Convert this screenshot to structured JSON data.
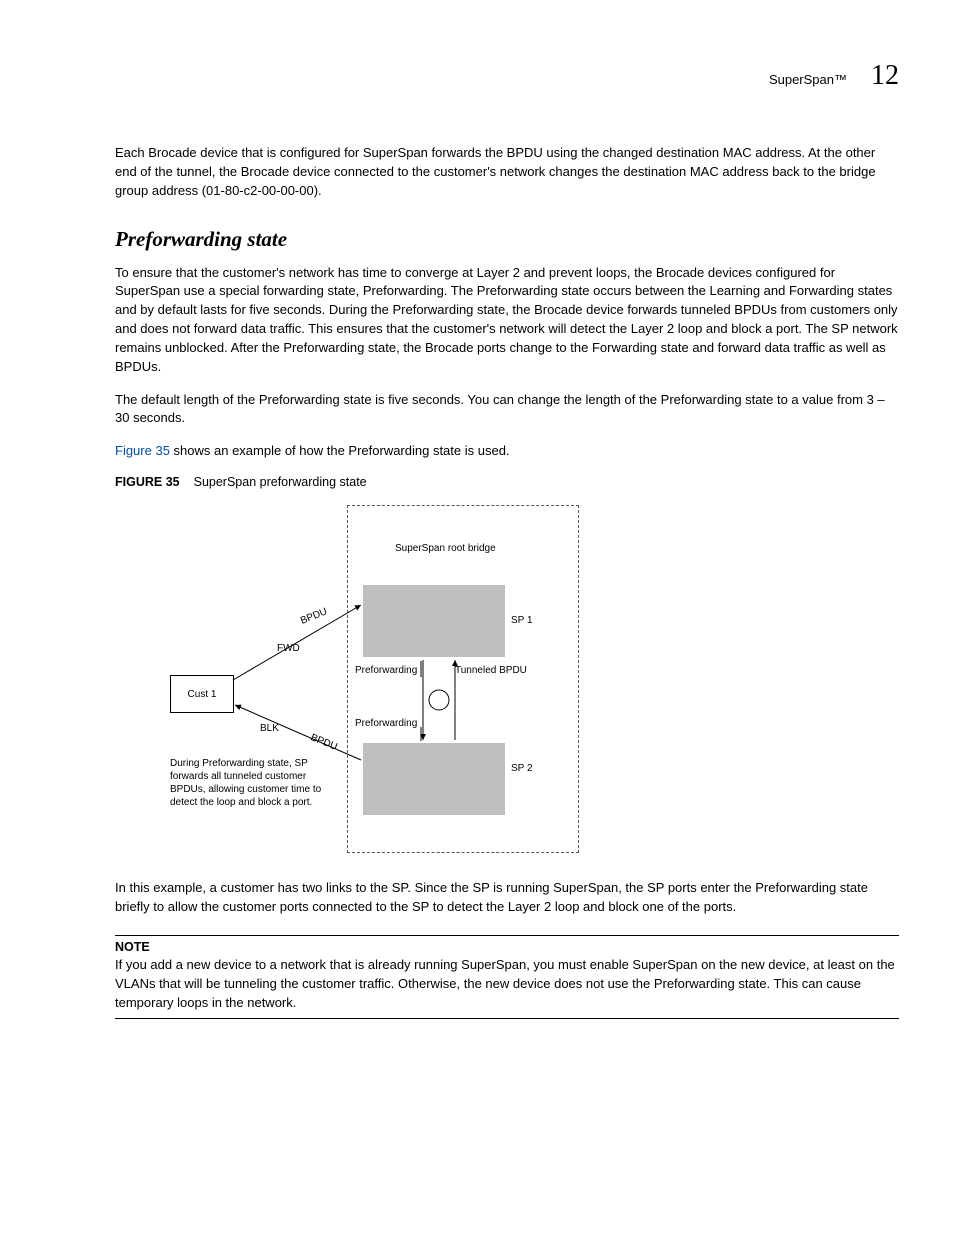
{
  "header": {
    "topic": "SuperSpan™",
    "chapter": "12"
  },
  "intro_para": "Each Brocade device that is configured for SuperSpan forwards the BPDU using the changed destination MAC address.  At the other end of the tunnel, the Brocade device connected to the customer's network changes the destination MAC address back to the bridge group address (01-80-c2-00-00-00).",
  "section_title": "Preforwarding state",
  "p1": "To ensure that the customer's network has time to converge at Layer 2 and prevent loops, the Brocade devices configured for SuperSpan use a special forwarding state, Preforwarding.  The Preforwarding state occurs between the Learning and Forwarding states and by default lasts for five seconds.  During the Preforwarding state, the Brocade device forwards tunneled BPDUs from customers only and does not forward data traffic.  This ensures that the customer's network will detect the Layer 2 loop and block a port.  The SP network remains unblocked.  After the Preforwarding state, the Brocade ports change to the Forwarding state and forward data traffic as well as BPDUs.",
  "p2": "The default length of the Preforwarding state is five seconds.  You can change the length of the Preforwarding state to a value from 3 – 30 seconds.",
  "p3_prefix": "",
  "figref": "Figure 35",
  "p3_suffix": " shows an example of how the Preforwarding state is used.",
  "figcap_label": "FIGURE 35",
  "figcap_text": "SuperSpan preforwarding state",
  "diagram": {
    "superspan": "SuperSpan root bridge",
    "sp1": "SP 1",
    "sp2": "SP 2",
    "cust": "Cust 1",
    "fwd": "FWD",
    "blk": "BLK",
    "pref": "Preforwarding",
    "tunnel": "Tunneled BPDU",
    "bpdu": "BPDU",
    "explain": "During Preforwarding state, SP forwards all tunneled customer BPDUs, allowing customer time to detect the loop and block a port."
  },
  "p4": "In this example, a customer has two links to the SP.  Since the SP is running SuperSpan, the SP ports enter the Preforwarding state briefly to allow the customer ports connected to the SP to detect the Layer 2 loop and block one of the ports.",
  "note_label": "NOTE",
  "note_text": "If you add a new device to a network that is already running SuperSpan, you must enable SuperSpan on the new device, at least on the VLANs that will be tunneling the customer traffic.  Otherwise, the new device does not use the Preforwarding state.  This can cause temporary loops in the network."
}
